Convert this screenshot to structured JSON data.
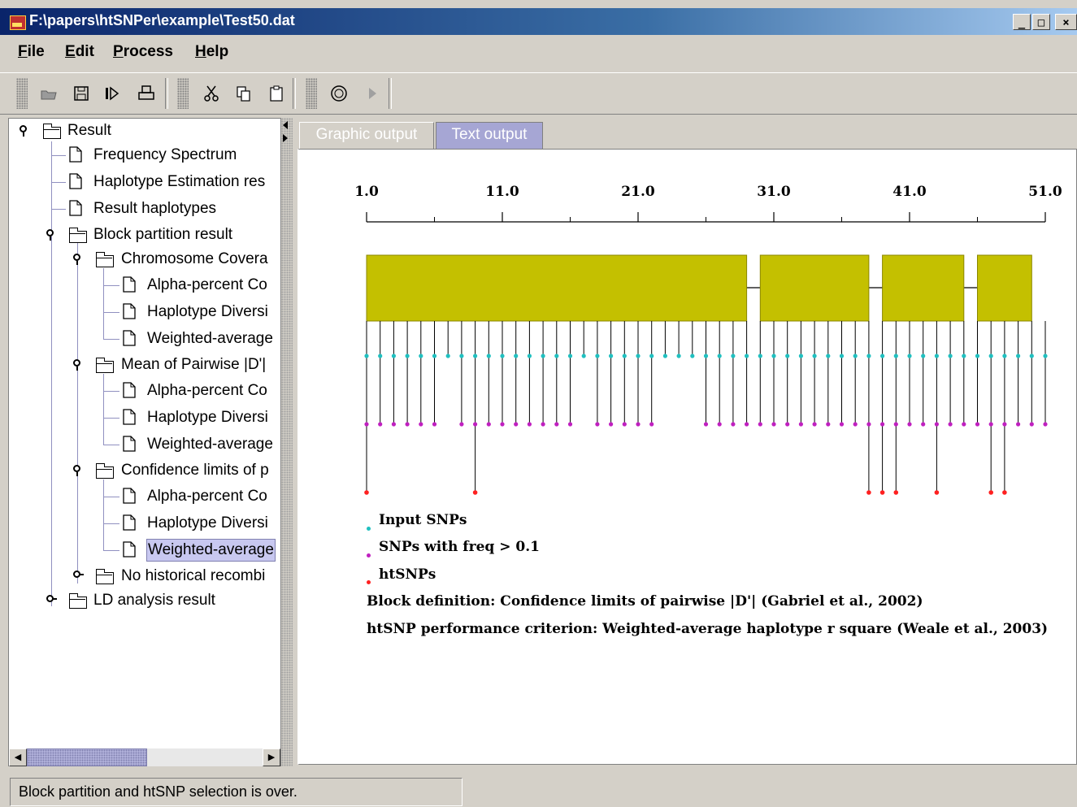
{
  "window": {
    "title": "F:\\papers\\htSNPer\\example\\Test50.dat",
    "btn_min": "_",
    "btn_max": "□",
    "btn_close": "×"
  },
  "menu": [
    "File",
    "Edit",
    "Process",
    "Help"
  ],
  "toolbar_icons": [
    "open-folder-icon",
    "save-icon",
    "export-icon",
    "print-icon",
    "cut-icon",
    "copy-icon",
    "paste-icon",
    "settings-icon",
    "run-icon"
  ],
  "tree": {
    "root": "Result",
    "frequency_spectrum": "Frequency Spectrum",
    "haplotype_estimation": "Haplotype Estimation res",
    "result_haplotypes": "Result haplotypes",
    "block_partition": "Block partition result",
    "chromosome_coverage": "Chromosome Covera",
    "cc_alpha": "Alpha-percent Co",
    "cc_diversity": "Haplotype Diversi",
    "cc_weighted": "Weighted-average",
    "mean_pairwise": "Mean of Pairwise |D'|",
    "mp_alpha": "Alpha-percent Co",
    "mp_diversity": "Haplotype Diversi",
    "mp_weighted": "Weighted-average",
    "confidence_limits": "Confidence limits of p",
    "cl_alpha": "Alpha-percent Co",
    "cl_diversity": "Haplotype Diversi",
    "cl_weighted": "Weighted-average",
    "no_historical": "No historical recombi",
    "ld_analysis": "LD analysis result"
  },
  "tabs": {
    "graphic": "Graphic output",
    "text": "Text output"
  },
  "chart_data": {
    "type": "snp-block-diagram",
    "axis_ticks": [
      "1.0",
      "11.0",
      "21.0",
      "31.0",
      "41.0",
      "51.0"
    ],
    "axis_range": [
      1,
      51
    ],
    "blocks": [
      [
        1,
        29
      ],
      [
        30,
        38
      ],
      [
        39,
        45
      ],
      [
        46,
        50
      ]
    ],
    "input_snps": [
      1,
      2,
      3,
      4,
      5,
      6,
      7,
      8,
      9,
      10,
      11,
      12,
      13,
      14,
      15,
      16,
      17,
      18,
      19,
      20,
      21,
      22,
      23,
      24,
      25,
      26,
      27,
      28,
      29,
      30,
      31,
      32,
      33,
      34,
      35,
      36,
      37,
      38,
      39,
      40,
      41,
      42,
      43,
      44,
      45,
      46,
      47,
      48,
      49,
      50,
      51
    ],
    "freq_snps": [
      1,
      2,
      3,
      4,
      5,
      6,
      8,
      9,
      10,
      11,
      12,
      13,
      14,
      15,
      16,
      18,
      19,
      20,
      21,
      22,
      26,
      27,
      28,
      29,
      30,
      31,
      32,
      33,
      34,
      35,
      36,
      37,
      38,
      39,
      40,
      41,
      42,
      43,
      44,
      45,
      46,
      47,
      48,
      49,
      50,
      51
    ],
    "htsnps": [
      1,
      9,
      38,
      39,
      40,
      43,
      47,
      48
    ],
    "colors": {
      "block": "#c4c000",
      "input": "#20c0c0",
      "freq": "#c020c0",
      "htsnp": "#ff2020"
    }
  },
  "legend": {
    "input": "Input SNPs",
    "freq": "SNPs with freq > 0.1",
    "htsnp": "htSNPs",
    "block_def": "Block definition: Confidence limits of pairwise |D'| (Gabriel et al., 2002)",
    "criterion": "htSNP performance criterion: Weighted-average haplotype r square (Weale et al., 2003)"
  },
  "status": "Block partition and htSNP selection is over."
}
